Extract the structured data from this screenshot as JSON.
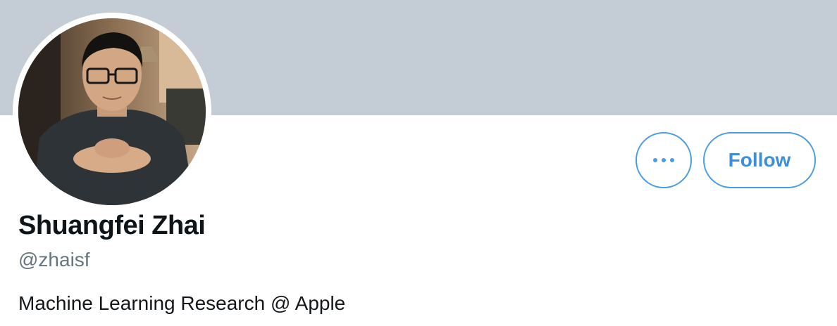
{
  "profile": {
    "name": "Shuangfei Zhai",
    "handle": "@zhaisf",
    "bio": "Machine Learning Research @ Apple"
  },
  "actions": {
    "follow_label": "Follow",
    "more_icon": "more-horizontal-icon"
  },
  "colors": {
    "banner": "#c4cdd5",
    "accent": "#4a9be6",
    "handle": "#66757f",
    "name": "#0f1419"
  }
}
